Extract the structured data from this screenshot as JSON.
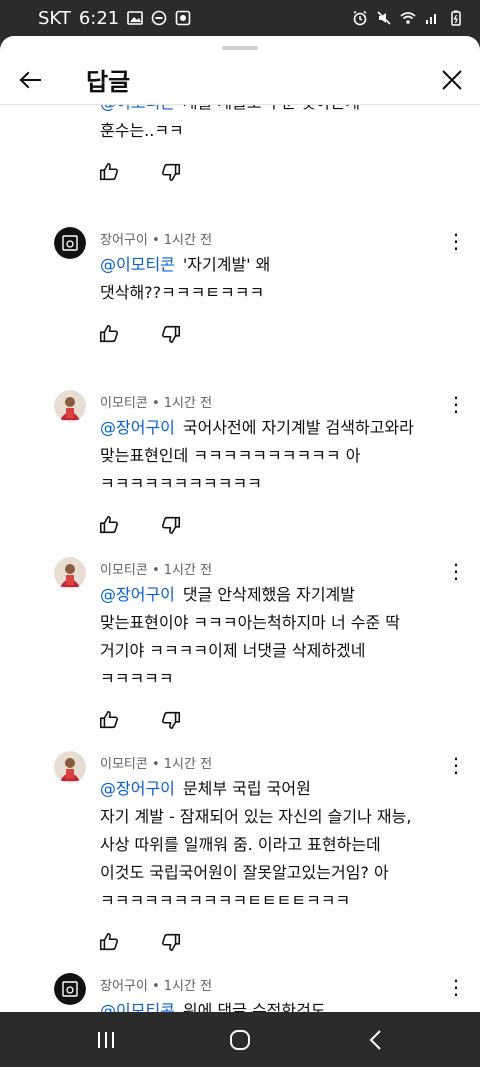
{
  "status": {
    "carrier": "SKT",
    "time": "6:21",
    "left_icons": [
      "image-icon",
      "dnd-icon",
      "media-icon"
    ],
    "right_icons": [
      "alarm-icon",
      "mute-icon",
      "wifi-icon",
      "signal-icon",
      "battery-icon"
    ]
  },
  "header": {
    "title": "답글"
  },
  "comments": [
    {
      "avatar": "dark",
      "author": "",
      "time": "",
      "mention": "@이모티콘",
      "text": "개를 계몰도 수준 맞아는게\n훈수는..ㅋㅋ",
      "partial": true
    },
    {
      "avatar": "dark",
      "author": "장어구이",
      "time": "1시간 전",
      "mention": "@이모티콘",
      "text": "'자기계발' 왜\n댓삭해??ㅋㅋㅋㅌㅋㅋㅋ"
    },
    {
      "avatar": "photo",
      "author": "이모티콘",
      "time": "1시간 전",
      "mention": "@장어구이",
      "text": "국어사전에 자기계발 검색하고와라\n맞는표현인데 ㅋㅋㅋㅋㅋㅋㅋㅋㅋㅋ 아\nㅋㅋㅋㅋㅋㅋㅋㅋㅋㅋㅋ"
    },
    {
      "avatar": "photo",
      "author": "이모티콘",
      "time": "1시간 전",
      "mention": "@장어구이",
      "text": "댓글 안삭제했음 자기계발\n맞는표현이야 ㅋㅋㅋ아는척하지마 너 수준 딱\n거기야 ㅋㅋㅋㅋ이제 너댓글 삭제하겠네\nㅋㅋㅋㅋㅋ"
    },
    {
      "avatar": "photo",
      "author": "이모티콘",
      "time": "1시간 전",
      "mention": "@장어구이",
      "text": "문체부 국립 국어원\n자기 계발 - 잠재되어 있는 자신의 슬기나 재능,\n사상 따위를 일깨워 줌. 이라고 표현하는데\n이것도 국립국어원이 잘못알고있는거임? 아\nㅋㅋㅋㅋㅋㅋㅋㅋㅋㅋㅌㅌㅌㅌㅋㅋㅋ"
    },
    {
      "avatar": "dark",
      "author": "장어구이",
      "time": "1시간 전",
      "mention": "@이모티콘",
      "text": "위에 댓글 수정한것도\n존나웃기네ㅋㅋㅋㅋㅋㅋㅋㅋ"
    }
  ],
  "meta_separator": " • ",
  "navbar": [
    "recent-apps-icon",
    "home-icon",
    "back-icon"
  ]
}
